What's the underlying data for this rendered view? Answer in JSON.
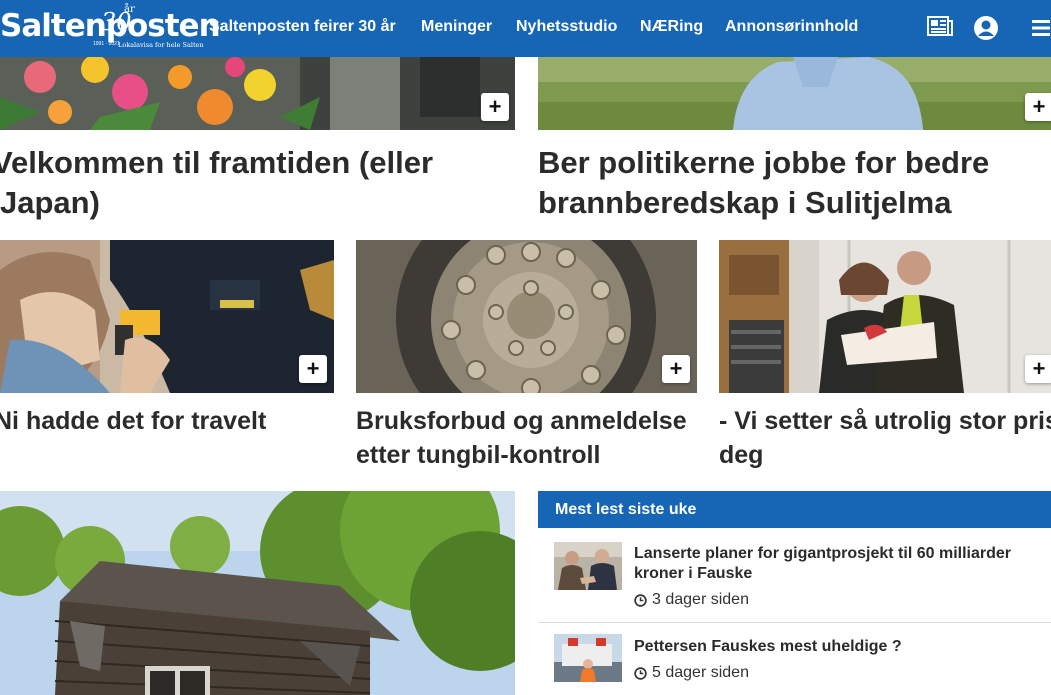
{
  "header": {
    "logo_text": "Saltenposten",
    "logo_tagline": "Lokalavisa for hele Salten",
    "logo_years": "1991 · 2021",
    "logo_badge": "år",
    "logo_number": "30",
    "nav": [
      {
        "label": "Saltenposten feirer 30 år"
      },
      {
        "label": "Meninger"
      },
      {
        "label": "Nyhetsstudio"
      },
      {
        "label": "NÆRing"
      },
      {
        "label": "Annonsørinnhold"
      }
    ],
    "brand_color": "#1766b6"
  },
  "articles": [
    {
      "title": "Velkommen til framtiden (eller Japan)"
    },
    {
      "title": "Ber politikerne jobbe for bedre brannberedskap i Sulitjelma"
    },
    {
      "title": "Ni hadde det for travelt"
    },
    {
      "title": "Bruksforbud og anmeldelse etter tungbil-kontroll"
    },
    {
      "title": "- Vi setter så utrolig stor pris på deg"
    }
  ],
  "plus_label": "+",
  "most_read": {
    "heading": "Mest lest siste uke",
    "items": [
      {
        "title": "Lanserte planer for gigantprosjekt til 60 milliarder kroner i Fauske",
        "time": "3 dager siden"
      },
      {
        "title": "Pettersen Fauskes mest uheldige ?",
        "time": "5 dager siden"
      }
    ]
  }
}
